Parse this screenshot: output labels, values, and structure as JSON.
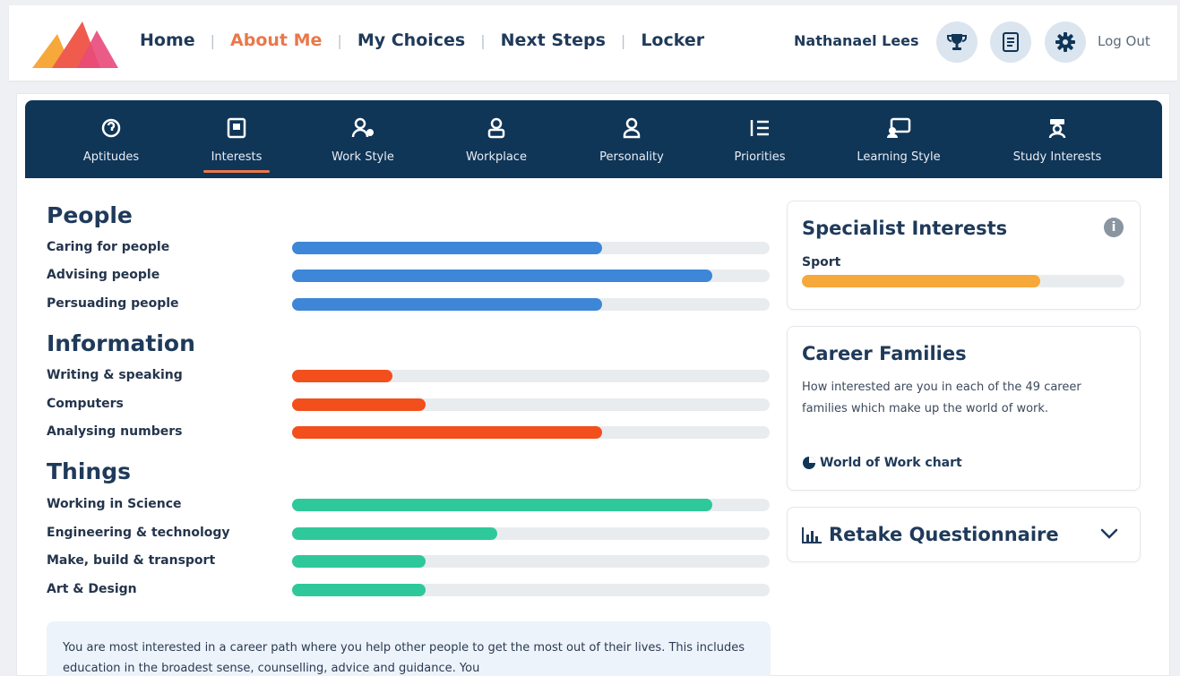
{
  "header": {
    "nav": [
      "Home",
      "About Me",
      "My Choices",
      "Next Steps",
      "Locker"
    ],
    "active_nav": "About Me",
    "user_name": "Nathanael Lees",
    "logout": "Log Out",
    "icons": [
      "trophy-icon",
      "document-icon",
      "gear-icon"
    ]
  },
  "tabs": [
    {
      "label": "Aptitudes",
      "icon": "aptitude-icon"
    },
    {
      "label": "Interests",
      "icon": "interests-icon",
      "active": true
    },
    {
      "label": "Work Style",
      "icon": "work-style-icon"
    },
    {
      "label": "Workplace",
      "icon": "workplace-icon"
    },
    {
      "label": "Personality",
      "icon": "personality-icon"
    },
    {
      "label": "Priorities",
      "icon": "priorities-icon"
    },
    {
      "label": "Learning Style",
      "icon": "learning-style-icon"
    },
    {
      "label": "Study Interests",
      "icon": "study-interests-icon"
    }
  ],
  "colors": {
    "people": "#3d86d8",
    "information": "#f24f1c",
    "things": "#2fc89a",
    "specialist": "#f7a83b",
    "accent": "#e9784a",
    "navy": "#0f3557"
  },
  "groups": [
    {
      "title": "People",
      "items": [
        {
          "label": "Caring for people",
          "value": 0.65
        },
        {
          "label": "Advising people",
          "value": 0.88
        },
        {
          "label": "Persuading people",
          "value": 0.65
        }
      ]
    },
    {
      "title": "Information",
      "items": [
        {
          "label": "Writing & speaking",
          "value": 0.21
        },
        {
          "label": "Computers",
          "value": 0.28
        },
        {
          "label": "Analysing numbers",
          "value": 0.65
        }
      ]
    },
    {
      "title": "Things",
      "items": [
        {
          "label": "Working in Science",
          "value": 0.88
        },
        {
          "label": "Engineering & technology",
          "value": 0.43
        },
        {
          "label": "Make, build & transport",
          "value": 0.28
        },
        {
          "label": "Art & Design",
          "value": 0.28
        }
      ]
    }
  ],
  "summary": "You are most interested in a career path where you help other people to get the most out of their lives. This includes education in the broadest sense, counselling, advice and guidance. You",
  "specialist": {
    "title": "Specialist Interests",
    "item_label": "Sport",
    "item_value": 0.74
  },
  "career_families": {
    "title": "Career Families",
    "description": "How interested are you in each of the 49 career families which make up the world of work.",
    "link": "World of Work chart"
  },
  "retake": {
    "label": "Retake Questionnaire"
  }
}
